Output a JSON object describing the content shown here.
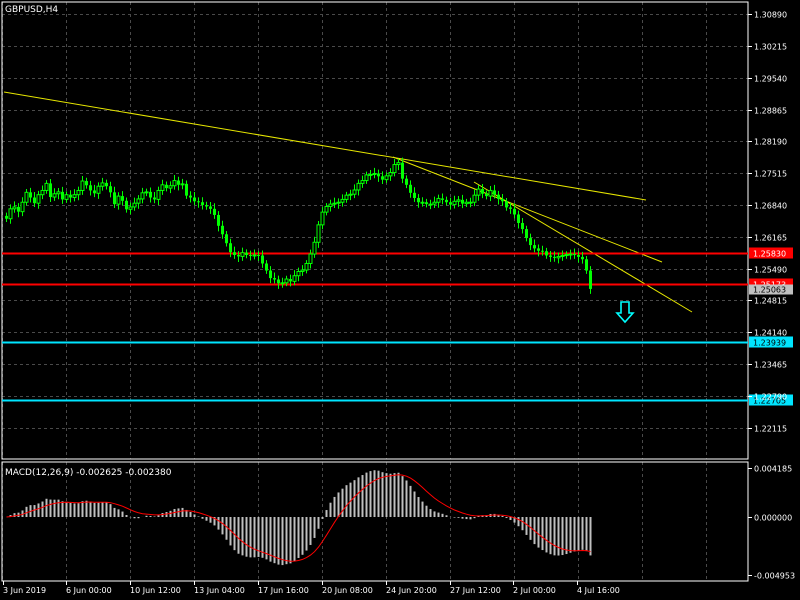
{
  "window": {
    "title": "GBPUSD,H4"
  },
  "indicator": {
    "title": "MACD(12,26,9) -0.002625 -0.002380",
    "name": "MACD(12,26,9)",
    "main_value": -0.002625,
    "signal_value": -0.00238,
    "axis_labels": [
      "0.004185",
      "0.000000",
      "-0.004953"
    ],
    "axis_values": [
      0.004185,
      0.0,
      -0.004953
    ]
  },
  "price_axis": {
    "labels": [
      "1.30890",
      "1.30215",
      "1.29540",
      "1.28865",
      "1.28190",
      "1.27515",
      "1.26840",
      "1.26165",
      "1.25490",
      "1.24815",
      "1.24140",
      "1.23465",
      "1.22790",
      "1.22115"
    ],
    "values": [
      1.3089,
      1.30215,
      1.2954,
      1.28865,
      1.2819,
      1.27515,
      1.2684,
      1.26165,
      1.2549,
      1.24815,
      1.2414,
      1.23465,
      1.2279,
      1.22115
    ]
  },
  "time_axis": {
    "labels": [
      "3 Jun 2019",
      "6 Jun 00:00",
      "10 Jun 12:00",
      "13 Jun 04:00",
      "17 Jun 16:00",
      "20 Jun 08:00",
      "24 Jun 20:00",
      "27 Jun 12:00",
      "2 Jul 00:00",
      "4 Jul 16:00"
    ]
  },
  "levels": [
    {
      "value": 1.2583,
      "label": "1.25830",
      "color": "#ff0000"
    },
    {
      "value": 1.25173,
      "label": "1.25173",
      "color": "#ff0000"
    },
    {
      "value": 1.23939,
      "label": "1.23939",
      "color": "#00e5ff"
    },
    {
      "value": 1.22705,
      "label": "1.22705",
      "color": "#00e5ff"
    }
  ],
  "bid_label": "1.25063",
  "colors": {
    "background": "#000000",
    "grid": "#4a4a4a",
    "candle": "#00ff00",
    "trendline": "#e6e600",
    "macd_histogram": "#c0c0c0",
    "macd_signal": "#ff0000",
    "arrow": "#00ffff",
    "text": "#ffffff"
  },
  "signal_icon": "down-arrow-icon",
  "chart_data": {
    "type": "candlestick",
    "symbol": "GBPUSD",
    "timeframe": "H4",
    "ylim": [
      1.2145,
      1.3115
    ],
    "closes": [
      1.2655,
      1.2676,
      1.268,
      1.267,
      1.269,
      1.2711,
      1.27,
      1.2688,
      1.2706,
      1.2715,
      1.273,
      1.2701,
      1.2708,
      1.2712,
      1.2696,
      1.2706,
      1.27,
      1.2706,
      1.2715,
      1.2735,
      1.2726,
      1.2715,
      1.2709,
      1.2724,
      1.2731,
      1.2724,
      1.2711,
      1.2686,
      1.2703,
      1.2693,
      1.2675,
      1.268,
      1.2688,
      1.2697,
      1.271,
      1.2712,
      1.27,
      1.2696,
      1.2715,
      1.2727,
      1.272,
      1.2725,
      1.2736,
      1.2727,
      1.2729,
      1.2704,
      1.27,
      1.2692,
      1.269,
      1.2684,
      1.2681,
      1.2676,
      1.2663,
      1.264,
      1.2622,
      1.2603,
      1.2584,
      1.2578,
      1.2575,
      1.2583,
      1.2578,
      1.2577,
      1.2578,
      1.2577,
      1.256,
      1.2545,
      1.2529,
      1.2526,
      1.2518,
      1.2519,
      1.2527,
      1.2522,
      1.2534,
      1.2543,
      1.2546,
      1.256,
      1.258,
      1.2605,
      1.2642,
      1.2669,
      1.2681,
      1.2686,
      1.2688,
      1.269,
      1.2696,
      1.2705,
      1.2707,
      1.2716,
      1.273,
      1.2736,
      1.2748,
      1.2749,
      1.2751,
      1.2745,
      1.2738,
      1.2746,
      1.2753,
      1.277,
      1.2774,
      1.274,
      1.2727,
      1.271,
      1.2699,
      1.269,
      1.269,
      1.2686,
      1.2686,
      1.269,
      1.2698,
      1.2695,
      1.269,
      1.2685,
      1.2692,
      1.2695,
      1.2687,
      1.269,
      1.269,
      1.2705,
      1.2718,
      1.2708,
      1.2703,
      1.2715,
      1.2706,
      1.2697,
      1.2692,
      1.2679,
      1.2676,
      1.2664,
      1.2646,
      1.2633,
      1.2614,
      1.2599,
      1.2592,
      1.2587,
      1.2586,
      1.2577,
      1.2574,
      1.2572,
      1.2575,
      1.2577,
      1.2579,
      1.258,
      1.2578,
      1.2574,
      1.2569,
      1.2545,
      1.2506
    ]
  }
}
